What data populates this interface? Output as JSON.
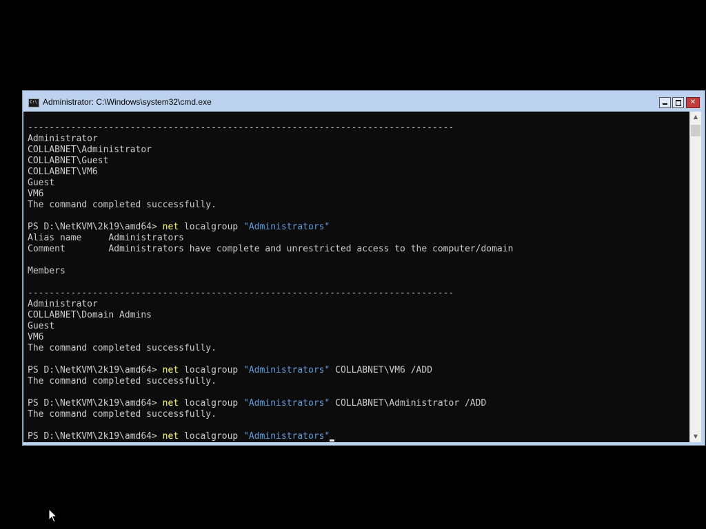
{
  "window": {
    "title": "Administrator: C:\\Windows\\system32\\cmd.exe",
    "icon": "cmd-icon",
    "controls": {
      "minimize_glyph": "",
      "maximize_glyph": "",
      "close_glyph": "✕"
    }
  },
  "colors": {
    "desktop": "#000000",
    "console_bg": "#0c0c0c",
    "text": "#cccccc",
    "command": "#ffff66",
    "string": "#5f9ee0",
    "titlebar": "#bcd2ee"
  },
  "console": {
    "lines": [
      [
        {
          "t": "-------------------------------------------------------------------------------",
          "c": "plain"
        }
      ],
      [
        {
          "t": "Administrator",
          "c": "plain"
        }
      ],
      [
        {
          "t": "COLLABNET\\Administrator",
          "c": "plain"
        }
      ],
      [
        {
          "t": "COLLABNET\\Guest",
          "c": "plain"
        }
      ],
      [
        {
          "t": "COLLABNET\\VM6",
          "c": "plain"
        }
      ],
      [
        {
          "t": "Guest",
          "c": "plain"
        }
      ],
      [
        {
          "t": "VM6",
          "c": "plain"
        }
      ],
      [
        {
          "t": "The command completed successfully.",
          "c": "plain"
        }
      ],
      [],
      [
        {
          "t": "PS D:\\NetKVM\\2k19\\amd64> ",
          "c": "plain"
        },
        {
          "t": "net",
          "c": "cmd"
        },
        {
          "t": " localgroup ",
          "c": "plain"
        },
        {
          "t": "\"Administrators\"",
          "c": "str"
        }
      ],
      [
        {
          "t": "Alias name     Administrators",
          "c": "plain"
        }
      ],
      [
        {
          "t": "Comment        Administrators have complete and unrestricted access to the computer/domain",
          "c": "plain"
        }
      ],
      [],
      [
        {
          "t": "Members",
          "c": "plain"
        }
      ],
      [],
      [
        {
          "t": "-------------------------------------------------------------------------------",
          "c": "plain"
        }
      ],
      [
        {
          "t": "Administrator",
          "c": "plain"
        }
      ],
      [
        {
          "t": "COLLABNET\\Domain Admins",
          "c": "plain"
        }
      ],
      [
        {
          "t": "Guest",
          "c": "plain"
        }
      ],
      [
        {
          "t": "VM6",
          "c": "plain"
        }
      ],
      [
        {
          "t": "The command completed successfully.",
          "c": "plain"
        }
      ],
      [],
      [
        {
          "t": "PS D:\\NetKVM\\2k19\\amd64> ",
          "c": "plain"
        },
        {
          "t": "net",
          "c": "cmd"
        },
        {
          "t": " localgroup ",
          "c": "plain"
        },
        {
          "t": "\"Administrators\"",
          "c": "str"
        },
        {
          "t": " COLLABNET\\VM6 /ADD",
          "c": "plain"
        }
      ],
      [
        {
          "t": "The command completed successfully.",
          "c": "plain"
        }
      ],
      [],
      [
        {
          "t": "PS D:\\NetKVM\\2k19\\amd64> ",
          "c": "plain"
        },
        {
          "t": "net",
          "c": "cmd"
        },
        {
          "t": " localgroup ",
          "c": "plain"
        },
        {
          "t": "\"Administrators\"",
          "c": "str"
        },
        {
          "t": " COLLABNET\\Administrator /ADD",
          "c": "plain"
        }
      ],
      [
        {
          "t": "The command completed successfully.",
          "c": "plain"
        }
      ],
      [],
      [
        {
          "t": "PS D:\\NetKVM\\2k19\\amd64> ",
          "c": "plain"
        },
        {
          "t": "net",
          "c": "cmd"
        },
        {
          "t": " localgroup ",
          "c": "plain"
        },
        {
          "t": "\"Administrators\"",
          "c": "str"
        }
      ]
    ],
    "cursor_after_last_line": true
  },
  "scrollbar": {
    "up_icon": "chevron-up-icon",
    "down_icon": "chevron-down-icon",
    "up_glyph": "▲",
    "down_glyph": "▼"
  },
  "pointer": {
    "icon": "mouse-pointer-icon"
  }
}
